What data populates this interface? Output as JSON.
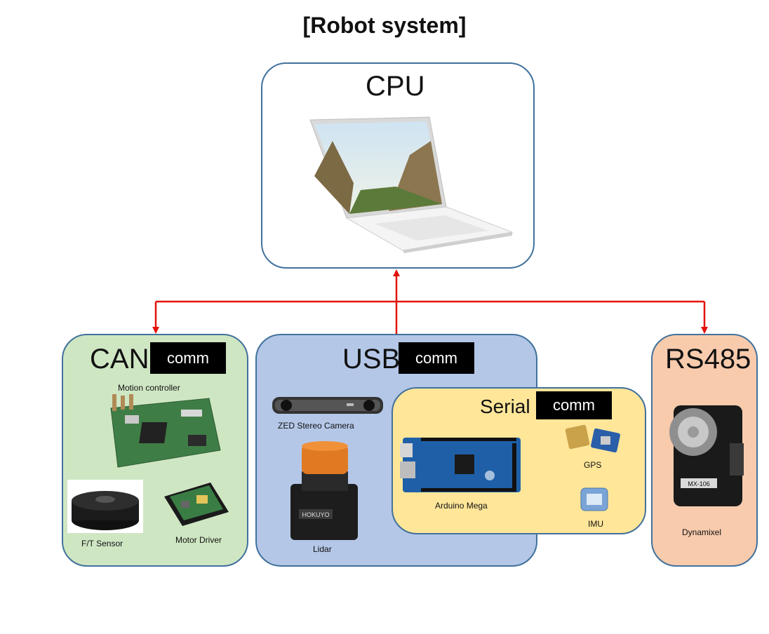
{
  "title": "[Robot system]",
  "cpu": {
    "label": "CPU"
  },
  "can": {
    "label": "CAN",
    "tag": "comm",
    "items": [
      "Motion controller",
      "F/T Sensor",
      "Motor Driver"
    ]
  },
  "usb": {
    "label": "USB",
    "tag": "comm",
    "items": [
      "ZED Stereo Camera",
      "Lidar"
    ]
  },
  "serial": {
    "label": "Serial",
    "tag": "comm",
    "items": [
      "Arduino Mega",
      "GPS",
      "IMU"
    ]
  },
  "rs485": {
    "label": "RS485",
    "items": [
      "Dynamixel"
    ]
  },
  "device_markings": {
    "lidar_brand": "HOKUYO",
    "servo_model": "MX-106"
  },
  "colors": {
    "wire": "#e3120b",
    "border": "#41719c",
    "can_bg": "#cfe6c3",
    "usb_bg": "#b4c7e7",
    "serial_bg": "#ffe699",
    "rs485_bg": "#f8cbad"
  }
}
